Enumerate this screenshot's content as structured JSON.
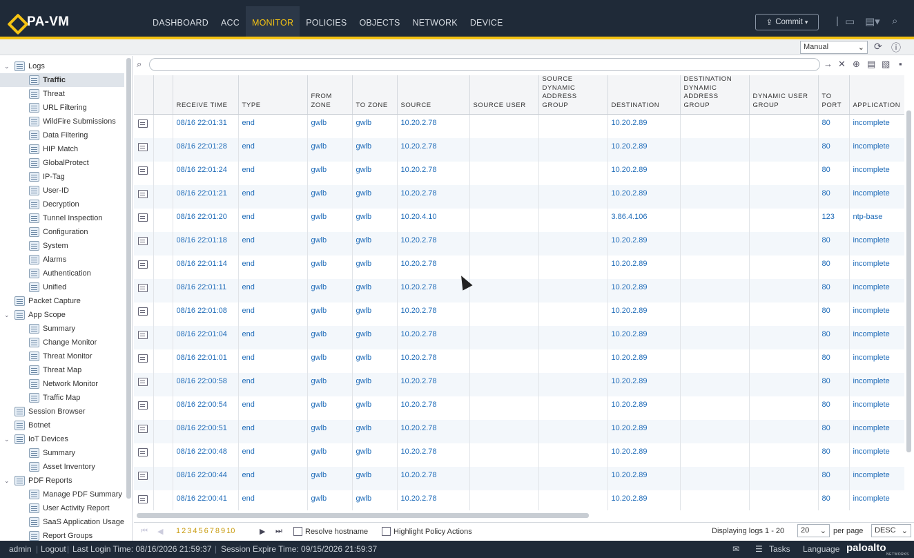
{
  "app": {
    "title": "PA-VM"
  },
  "nav": {
    "tabs": [
      {
        "label": "DASHBOARD",
        "active": false
      },
      {
        "label": "ACC",
        "active": false
      },
      {
        "label": "MONITOR",
        "active": true
      },
      {
        "label": "POLICIES",
        "active": false
      },
      {
        "label": "OBJECTS",
        "active": false
      },
      {
        "label": "NETWORK",
        "active": false
      },
      {
        "label": "DEVICE",
        "active": false
      }
    ]
  },
  "toolbar": {
    "commit_label": "Commit",
    "refresh_select": "Manual"
  },
  "sidebar": {
    "items": [
      {
        "label": "Logs",
        "level": 0,
        "toggle": "v"
      },
      {
        "label": "Traffic",
        "level": 1,
        "selected": true
      },
      {
        "label": "Threat",
        "level": 1
      },
      {
        "label": "URL Filtering",
        "level": 1
      },
      {
        "label": "WildFire Submissions",
        "level": 1
      },
      {
        "label": "Data Filtering",
        "level": 1
      },
      {
        "label": "HIP Match",
        "level": 1
      },
      {
        "label": "GlobalProtect",
        "level": 1
      },
      {
        "label": "IP-Tag",
        "level": 1
      },
      {
        "label": "User-ID",
        "level": 1
      },
      {
        "label": "Decryption",
        "level": 1
      },
      {
        "label": "Tunnel Inspection",
        "level": 1
      },
      {
        "label": "Configuration",
        "level": 1
      },
      {
        "label": "System",
        "level": 1
      },
      {
        "label": "Alarms",
        "level": 1
      },
      {
        "label": "Authentication",
        "level": 1
      },
      {
        "label": "Unified",
        "level": 1
      },
      {
        "label": "Packet Capture",
        "level": 0
      },
      {
        "label": "App Scope",
        "level": 0,
        "toggle": "v"
      },
      {
        "label": "Summary",
        "level": 1
      },
      {
        "label": "Change Monitor",
        "level": 1
      },
      {
        "label": "Threat Monitor",
        "level": 1
      },
      {
        "label": "Threat Map",
        "level": 1
      },
      {
        "label": "Network Monitor",
        "level": 1
      },
      {
        "label": "Traffic Map",
        "level": 1
      },
      {
        "label": "Session Browser",
        "level": 0
      },
      {
        "label": "Botnet",
        "level": 0
      },
      {
        "label": "IoT Devices",
        "level": 0,
        "toggle": "v"
      },
      {
        "label": "Summary",
        "level": 1
      },
      {
        "label": "Asset Inventory",
        "level": 1
      },
      {
        "label": "PDF Reports",
        "level": 0,
        "toggle": "v"
      },
      {
        "label": "Manage PDF Summary",
        "level": 1
      },
      {
        "label": "User Activity Report",
        "level": 1
      },
      {
        "label": "SaaS Application Usage",
        "level": 1
      },
      {
        "label": "Report Groups",
        "level": 1
      }
    ]
  },
  "table": {
    "columns": [
      "RECEIVE TIME",
      "TYPE",
      "FROM ZONE",
      "TO ZONE",
      "SOURCE",
      "SOURCE USER",
      "SOURCE DYNAMIC ADDRESS GROUP",
      "DESTINATION",
      "DESTINATION DYNAMIC ADDRESS GROUP",
      "DYNAMIC USER GROUP",
      "TO PORT",
      "APPLICATION"
    ],
    "rows": [
      [
        "08/16 22:01:31",
        "end",
        "gwlb",
        "gwlb",
        "10.20.2.78",
        "",
        "",
        "10.20.2.89",
        "",
        "",
        "80",
        "incomplete"
      ],
      [
        "08/16 22:01:28",
        "end",
        "gwlb",
        "gwlb",
        "10.20.2.78",
        "",
        "",
        "10.20.2.89",
        "",
        "",
        "80",
        "incomplete"
      ],
      [
        "08/16 22:01:24",
        "end",
        "gwlb",
        "gwlb",
        "10.20.2.78",
        "",
        "",
        "10.20.2.89",
        "",
        "",
        "80",
        "incomplete"
      ],
      [
        "08/16 22:01:21",
        "end",
        "gwlb",
        "gwlb",
        "10.20.2.78",
        "",
        "",
        "10.20.2.89",
        "",
        "",
        "80",
        "incomplete"
      ],
      [
        "08/16 22:01:20",
        "end",
        "gwlb",
        "gwlb",
        "10.20.4.10",
        "",
        "",
        "3.86.4.106",
        "",
        "",
        "123",
        "ntp-base"
      ],
      [
        "08/16 22:01:18",
        "end",
        "gwlb",
        "gwlb",
        "10.20.2.78",
        "",
        "",
        "10.20.2.89",
        "",
        "",
        "80",
        "incomplete"
      ],
      [
        "08/16 22:01:14",
        "end",
        "gwlb",
        "gwlb",
        "10.20.2.78",
        "",
        "",
        "10.20.2.89",
        "",
        "",
        "80",
        "incomplete"
      ],
      [
        "08/16 22:01:11",
        "end",
        "gwlb",
        "gwlb",
        "10.20.2.78",
        "",
        "",
        "10.20.2.89",
        "",
        "",
        "80",
        "incomplete"
      ],
      [
        "08/16 22:01:08",
        "end",
        "gwlb",
        "gwlb",
        "10.20.2.78",
        "",
        "",
        "10.20.2.89",
        "",
        "",
        "80",
        "incomplete"
      ],
      [
        "08/16 22:01:04",
        "end",
        "gwlb",
        "gwlb",
        "10.20.2.78",
        "",
        "",
        "10.20.2.89",
        "",
        "",
        "80",
        "incomplete"
      ],
      [
        "08/16 22:01:01",
        "end",
        "gwlb",
        "gwlb",
        "10.20.2.78",
        "",
        "",
        "10.20.2.89",
        "",
        "",
        "80",
        "incomplete"
      ],
      [
        "08/16 22:00:58",
        "end",
        "gwlb",
        "gwlb",
        "10.20.2.78",
        "",
        "",
        "10.20.2.89",
        "",
        "",
        "80",
        "incomplete"
      ],
      [
        "08/16 22:00:54",
        "end",
        "gwlb",
        "gwlb",
        "10.20.2.78",
        "",
        "",
        "10.20.2.89",
        "",
        "",
        "80",
        "incomplete"
      ],
      [
        "08/16 22:00:51",
        "end",
        "gwlb",
        "gwlb",
        "10.20.2.78",
        "",
        "",
        "10.20.2.89",
        "",
        "",
        "80",
        "incomplete"
      ],
      [
        "08/16 22:00:48",
        "end",
        "gwlb",
        "gwlb",
        "10.20.2.78",
        "",
        "",
        "10.20.2.89",
        "",
        "",
        "80",
        "incomplete"
      ],
      [
        "08/16 22:00:44",
        "end",
        "gwlb",
        "gwlb",
        "10.20.2.78",
        "",
        "",
        "10.20.2.89",
        "",
        "",
        "80",
        "incomplete"
      ],
      [
        "08/16 22:00:41",
        "end",
        "gwlb",
        "gwlb",
        "10.20.2.78",
        "",
        "",
        "10.20.2.89",
        "",
        "",
        "80",
        "incomplete"
      ]
    ]
  },
  "pager": {
    "pages": [
      "1",
      "2",
      "3",
      "4",
      "5",
      "6",
      "7",
      "8",
      "9",
      "10"
    ],
    "resolve_hostname": "Resolve hostname",
    "highlight_policy": "Highlight Policy Actions",
    "displaying": "Displaying logs 1 - 20",
    "per_page_value": "20",
    "per_page_label": "per page",
    "sort_value": "DESC"
  },
  "status": {
    "user": "admin",
    "logout": "Logout",
    "last_login": "Last Login Time: 08/16/2026 21:59:37",
    "session_expire": "Session Expire Time: 09/15/2026 21:59:37",
    "tasks": "Tasks",
    "language": "Language",
    "brand": "paloalto",
    "brand_sub": "NETWORKS"
  },
  "colors": {
    "nav_bg": "#1f2a38",
    "accent": "#f5c313",
    "link": "#1e6bb8"
  }
}
